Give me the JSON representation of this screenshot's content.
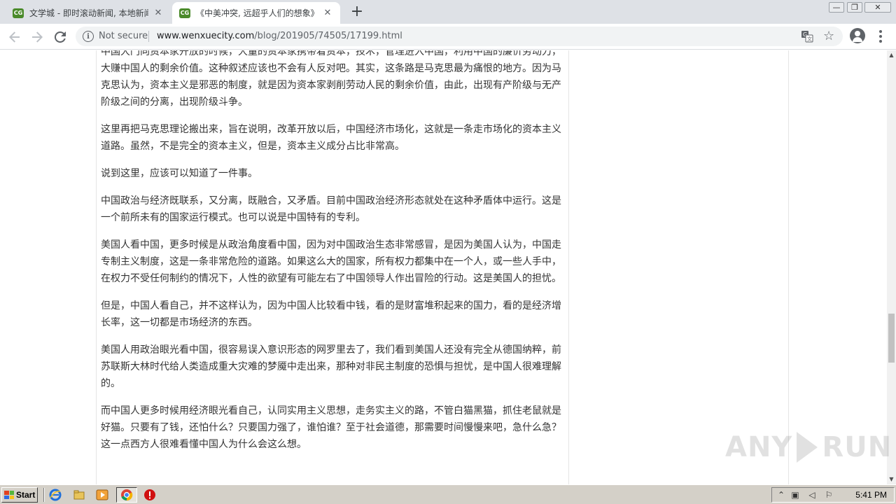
{
  "browser": {
    "tabs": [
      {
        "favicon": "CG",
        "title": "文学城 - 即时滚动新闻, 本地新闻, 社",
        "close": "✕"
      },
      {
        "favicon": "CG",
        "title": "《中美冲突, 远超乎人们的想象》| we",
        "close": "✕"
      }
    ],
    "new_tab": "+",
    "window_controls": {
      "minimize": "—",
      "maximize": "❐",
      "close": "✕"
    },
    "security_label": "Not secure",
    "url_host": "www.wenxuecity.com",
    "url_path": "/blog/201905/74505/17199.html"
  },
  "article": {
    "paragraphs": [
      "中国大门向资本家开放的时候，大量的资本家携带着资本，技术，管理进入中国，利用中国的廉价劳动力，大赚中国人的剩余价值。这种叙述应该也不会有人反对吧。其实，这条路是马克思最为痛恨的地方。因为马克思认为，资本主义是邪恶的制度，就是因为资本家剥削劳动人民的剩余价值，由此，出现有产阶级与无产阶级之间的分离，出现阶级斗争。",
      "这里再把马克思理论搬出来，旨在说明，改革开放以后，中国经济市场化，这就是一条走市场化的资本主义道路。虽然，不是完全的资本主义，但是，资本主义成分占比非常高。",
      "说到这里，应该可以知道了一件事。",
      "中国政治与经济既联系，又分离，既融合，又矛盾。目前中国政治经济形态就处在这种矛盾体中运行。这是一个前所未有的国家运行模式。也可以说是中国特有的专利。",
      "美国人看中国，更多时候是从政治角度看中国，因为对中国政治生态非常感冒，是因为美国人认为，中国走专制主义制度，这是一条非常危险的道路。如果这么大的国家，所有权力都集中在一个人，或一些人手中，在权力不受任何制约的情况下，人性的欲望有可能左右了中国领导人作出冒险的行动。这是美国人的担忧。",
      "但是，中国人看自己，并不这样认为，因为中国人比较看中钱，看的是财富堆积起来的国力，看的是经济增长率，这一切都是市场经济的东西。",
      "美国人用政治眼光看中国，很容易误入意识形态的网罗里去了，我们看到美国人还没有完全从德国纳粹，前苏联斯大林时代给人类造成重大灾难的梦魇中走出来，那种对非民主制度的恐惧与担忧，是中国人很难理解的。",
      "而中国人更多时候用经济眼光看自己，认同实用主义思想，走务实主义的路，不管白猫黑猫，抓住老鼠就是好猫。只要有了钱，还怕什么？只要国力强了，谁怕谁？至于社会道德，那需要时间慢慢来吧，急什么急？这一点西方人很难看懂中国人为什么会这么想。"
    ]
  },
  "watermark": {
    "left": "ANY",
    "right": "RUN"
  },
  "taskbar": {
    "start_label": "Start",
    "clock": "5:41 PM"
  }
}
